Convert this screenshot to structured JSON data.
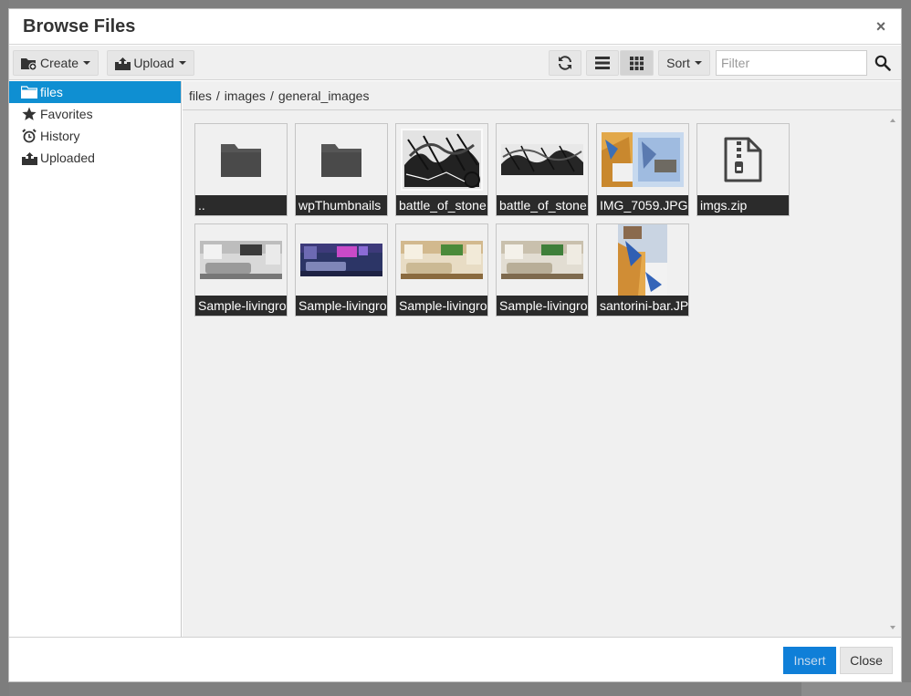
{
  "dialog": {
    "title": "Browse Files",
    "close_glyph": "×"
  },
  "toolbar": {
    "create_label": "Create",
    "upload_label": "Upload",
    "sort_label": "Sort",
    "filter_placeholder": "Filter",
    "icons": [
      "new-folder-icon",
      "upload-icon",
      "refresh-icon",
      "list-view-icon",
      "grid-view-icon",
      "search-icon"
    ]
  },
  "sidebar": {
    "items": [
      {
        "label": "files",
        "icon": "folder-icon",
        "active": true
      },
      {
        "label": "Favorites",
        "icon": "star-icon",
        "active": false
      },
      {
        "label": "History",
        "icon": "alarm-clock-icon",
        "active": false
      },
      {
        "label": "Uploaded",
        "icon": "upload-box-icon",
        "active": false
      }
    ]
  },
  "breadcrumb": {
    "parts": [
      "files",
      "images",
      "general_images"
    ],
    "separator": "/"
  },
  "files": [
    {
      "name": "..",
      "kind": "folder"
    },
    {
      "name": "wpThumbnails",
      "kind": "folder"
    },
    {
      "name": "battle_of_stone",
      "kind": "image"
    },
    {
      "name": "battle_of_stone",
      "kind": "image"
    },
    {
      "name": "IMG_7059.JPG",
      "kind": "image"
    },
    {
      "name": "imgs.zip",
      "kind": "zip"
    },
    {
      "name": "Sample-livingro",
      "kind": "image"
    },
    {
      "name": "Sample-livingro",
      "kind": "image"
    },
    {
      "name": "Sample-livingro",
      "kind": "image"
    },
    {
      "name": "Sample-livingro",
      "kind": "image"
    },
    {
      "name": "santorini-bar.JP",
      "kind": "image"
    }
  ],
  "footer": {
    "insert_label": "Insert",
    "close_label": "Close"
  },
  "colors": {
    "accent": "#0f8fd2",
    "insert_button": "#0f7fd8",
    "tile_caption": "#2b2b2b"
  }
}
